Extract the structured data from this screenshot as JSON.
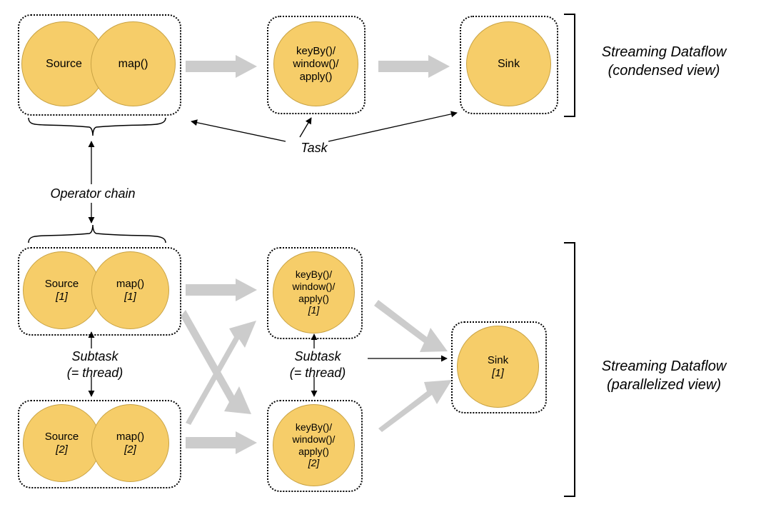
{
  "colors": {
    "opFill": "#F6CD69",
    "opStroke": "#C9A344",
    "flowArrow": "#CCCCCC",
    "textArrow": "#000000"
  },
  "sections": {
    "condensed": {
      "title": "Streaming Dataflow",
      "subtitle": "(condensed view)"
    },
    "parallel": {
      "title": "Streaming Dataflow",
      "subtitle": "(parallelized view)"
    }
  },
  "labels": {
    "task": "Task",
    "operatorChain": "Operator chain",
    "subtask1": "Subtask\n(= thread)",
    "subtask2": "Subtask\n(= thread)"
  },
  "condensed": {
    "source": "Source",
    "map": "map()",
    "middle_l1": "keyBy()/",
    "middle_l2": "window()/",
    "middle_l3": "apply()",
    "sink": "Sink"
  },
  "parallel": {
    "source1": "Source",
    "source1_idx": "[1]",
    "map1": "map()",
    "map1_idx": "[1]",
    "source2": "Source",
    "source2_idx": "[2]",
    "map2": "map()",
    "map2_idx": "[2]",
    "middle1_l1": "keyBy()/",
    "middle1_l2": "window()/",
    "middle1_l3": "apply()",
    "middle1_idx": "[1]",
    "middle2_l1": "keyBy()/",
    "middle2_l2": "window()/",
    "middle2_l3": "apply()",
    "middle2_idx": "[2]",
    "sink1": "Sink",
    "sink1_idx": "[1]"
  }
}
